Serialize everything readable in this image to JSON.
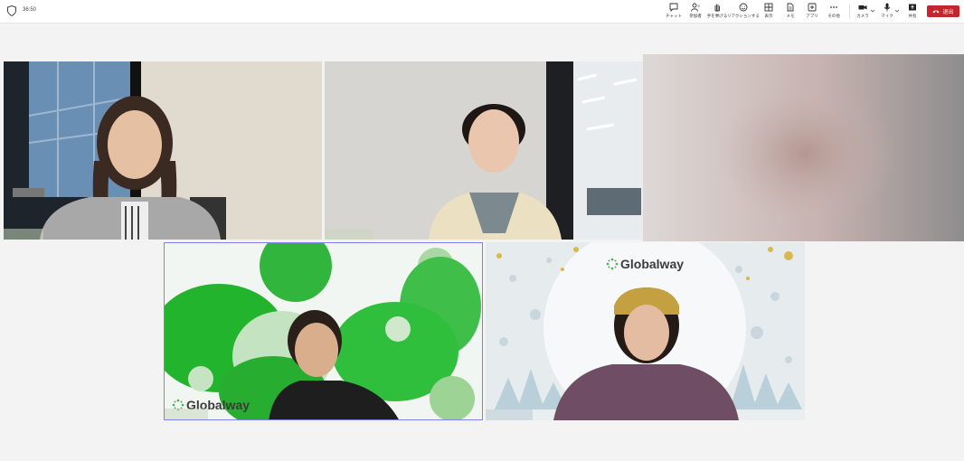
{
  "meeting": {
    "timer": "36:50"
  },
  "toolbar": {
    "items": [
      {
        "label": "チャット",
        "icon": "chat-icon"
      },
      {
        "label": "参加者",
        "icon": "people-icon"
      },
      {
        "label": "手を挙げる",
        "icon": "raise-hand-icon"
      },
      {
        "label": "リアクションする",
        "icon": "reaction-icon"
      },
      {
        "label": "表示",
        "icon": "view-icon"
      },
      {
        "label": "メモ",
        "icon": "notes-icon"
      },
      {
        "label": "アプリ",
        "icon": "apps-icon"
      },
      {
        "label": "その他",
        "icon": "more-icon"
      },
      {
        "label": "カメラ",
        "icon": "camera-icon"
      },
      {
        "label": "マイク",
        "icon": "mic-icon"
      },
      {
        "label": "共有",
        "icon": "share-icon"
      }
    ],
    "leave_label": "退出",
    "leave_color": "#c4262e"
  },
  "participants": {
    "background_logo": "Globalway",
    "brand_green": "#2fbf3c"
  }
}
